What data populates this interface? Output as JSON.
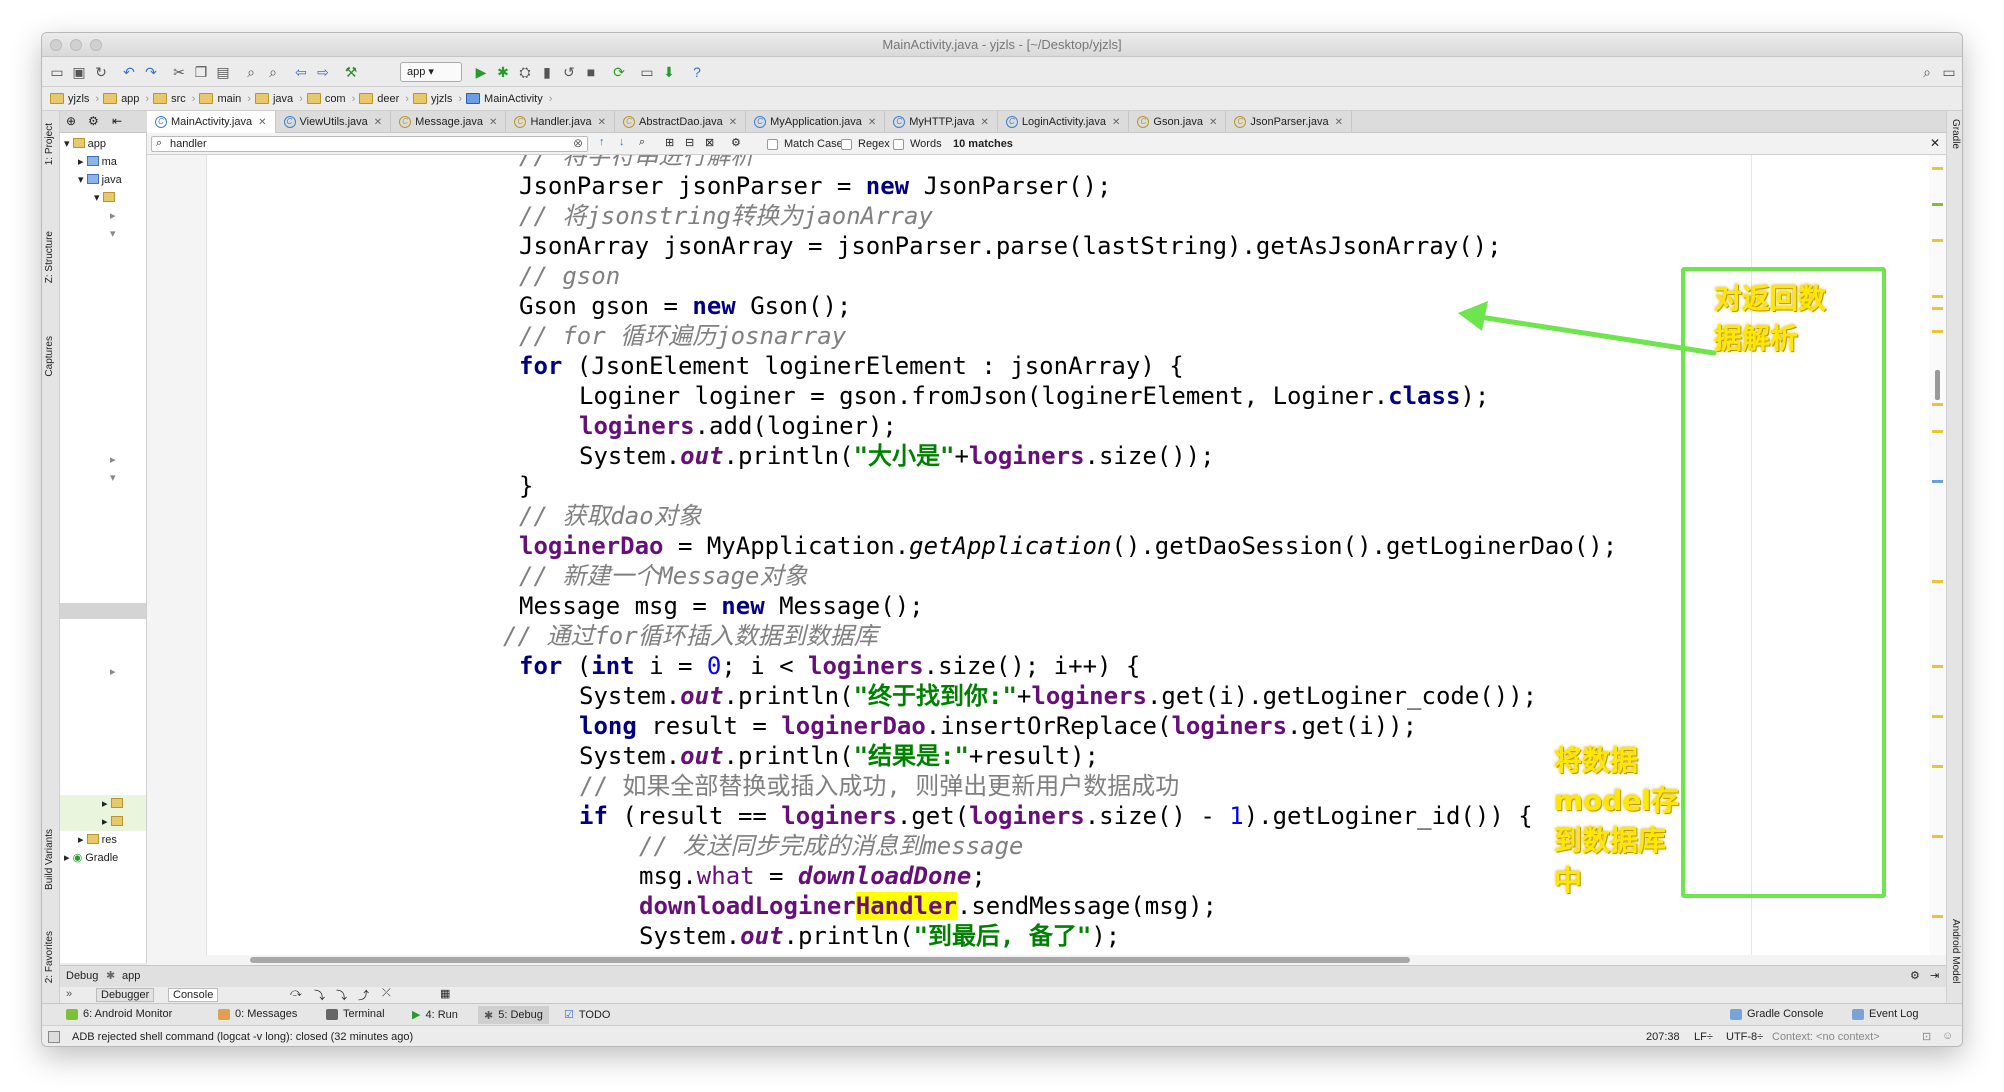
{
  "window": {
    "title": "MainActivity.java - yjzls - [~/Desktop/yjzls]"
  },
  "toolbar": {
    "run_config": "app ▾"
  },
  "breadcrumbs": [
    "yjzls",
    "app",
    "src",
    "main",
    "java",
    "com",
    "deer",
    "yjzls",
    "MainActivity"
  ],
  "tabs": [
    {
      "label": "MainActivity.java",
      "active": true
    },
    {
      "label": "ViewUtils.java"
    },
    {
      "label": "Message.java"
    },
    {
      "label": "Handler.java"
    },
    {
      "label": "AbstractDao.java"
    },
    {
      "label": "MyApplication.java"
    },
    {
      "label": "MyHTTP.java"
    },
    {
      "label": "LoginActivity.java"
    },
    {
      "label": "Gson.java"
    },
    {
      "label": "JsonParser.java"
    }
  ],
  "project_tree": {
    "root": "app",
    "items": [
      "ma",
      "java",
      "res",
      "Gradle"
    ]
  },
  "side_labels": {
    "project": "1: Project",
    "structure": "Z: Structure",
    "captures": "Captures",
    "build_variants": "Build Variants",
    "favorites": "2: Favorites",
    "gradle": "Gradle",
    "android_model": "Android Model"
  },
  "search": {
    "value": "handler",
    "match_case": "Match Case",
    "regex": "Regex",
    "words": "Words",
    "matches": "10 matches"
  },
  "code": {
    "l0": "// 将字符串进行解析",
    "l1a": "JsonParser jsonParser = ",
    "l1b": "new",
    "l1c": " JsonParser();",
    "l2a": "// 将",
    "l2b": "jsonstring",
    "l2c": "转换为",
    "l2d": "jaonArray",
    "l3": "JsonArray jsonArray = jsonParser.parse(lastString).getAsJsonArray();",
    "l4": "// gson",
    "l5a": "Gson gson = ",
    "l5b": "new",
    "l5c": " Gson();",
    "l6a": "// for 循环遍历",
    "l6b": "josnarray",
    "l7a": "for",
    "l7b": " (JsonElement loginerElement : jsonArray) {",
    "l8a": "Loginer loginer = gson.fromJson(loginerElement, Loginer.",
    "l8b": "class",
    "l8c": ");",
    "l9a": "loginers",
    "l9b": ".add(loginer);",
    "l10a": "System.",
    "l10b": "out",
    "l10c": ".println(",
    "l10d": "\"大小是\"",
    "l10e": "+",
    "l10f": "loginers",
    "l10g": ".size());",
    "l11": "}",
    "l12a": "// 获取",
    "l12b": "dao",
    "l12c": "对象",
    "l13a": "loginerDao",
    "l13b": " = MyApplication.",
    "l13c": "getApplication",
    "l13d": "().getDaoSession().getLoginerDao();",
    "l14a": "// 新建一个",
    "l14b": "Message",
    "l14c": "对象",
    "l15a": "Message msg = ",
    "l15b": "new",
    "l15c": " Message();",
    "l16a": "// 通过",
    "l16b": "for",
    "l16c": "循环插入数据到数据库",
    "l17a": "for",
    "l17b": " (",
    "l17c": "int",
    "l17d": " i = ",
    "l17e": "0",
    "l17f": "; i < ",
    "l17g": "loginers",
    "l17h": ".size(); i++) {",
    "l18a": "System.",
    "l18b": "out",
    "l18c": ".println(",
    "l18d": "\"终于找到你:\"",
    "l18e": "+",
    "l18f": "loginers",
    "l18g": ".get(i).getLoginer_code());",
    "l19a": "long",
    "l19b": " result = ",
    "l19c": "loginerDao",
    "l19d": ".insertOrReplace(",
    "l19e": "loginers",
    "l19f": ".get(i));",
    "l20a": "System.",
    "l20b": "out",
    "l20c": ".println(",
    "l20d": "\"结果是:\"",
    "l20e": "+result);",
    "l21": "// 如果全部替换或插入成功, 则弹出更新用户数据成功",
    "l22a": "if",
    "l22b": " (result == ",
    "l22c": "loginers",
    "l22d": ".get(",
    "l22e": "loginers",
    "l22f": ".size() - ",
    "l22g": "1",
    "l22h": ").getLoginer_id()) {",
    "l23a": "// 发送同步完成的消息到",
    "l23b": "message",
    "l24a": "msg.",
    "l24b": "what",
    "l24c": " = ",
    "l24d": "downloadDone",
    "l24e": ";",
    "l25a": "downloadLoginer",
    "l25b": "Handler",
    "l25c": ".sendMessage(msg);",
    "l26a": "System.",
    "l26b": "out",
    "l26c": ".println(",
    "l26d": "\"到最后, 备了\"",
    "l26e": ");"
  },
  "annotations": {
    "parse_note": "对返回数据解析",
    "save_note": "将数据model存到数据库中"
  },
  "debug": {
    "label": "Debug",
    "config": "app",
    "debugger_tab": "Debugger",
    "console_tab": "Console"
  },
  "tool_windows": {
    "android_monitor": "6: Android Monitor",
    "messages": "0: Messages",
    "terminal": "Terminal",
    "run": "4: Run",
    "debug": "5: Debug",
    "todo": "TODO",
    "gradle_console": "Gradle Console",
    "event_log": "Event Log"
  },
  "status": {
    "message": "ADB rejected shell command (logcat -v long): closed (32 minutes ago)",
    "position": "207:38",
    "line_sep": "LF÷",
    "encoding": "UTF-8÷",
    "context": "Context: <no context>"
  },
  "colors": {
    "annotation_box": "#6ee44d",
    "annotation_text": "#ffe800",
    "keyword": "#000080",
    "string": "#008000",
    "comment": "#808080",
    "field": "#660e7a",
    "search_highlight": "#ffff00"
  }
}
